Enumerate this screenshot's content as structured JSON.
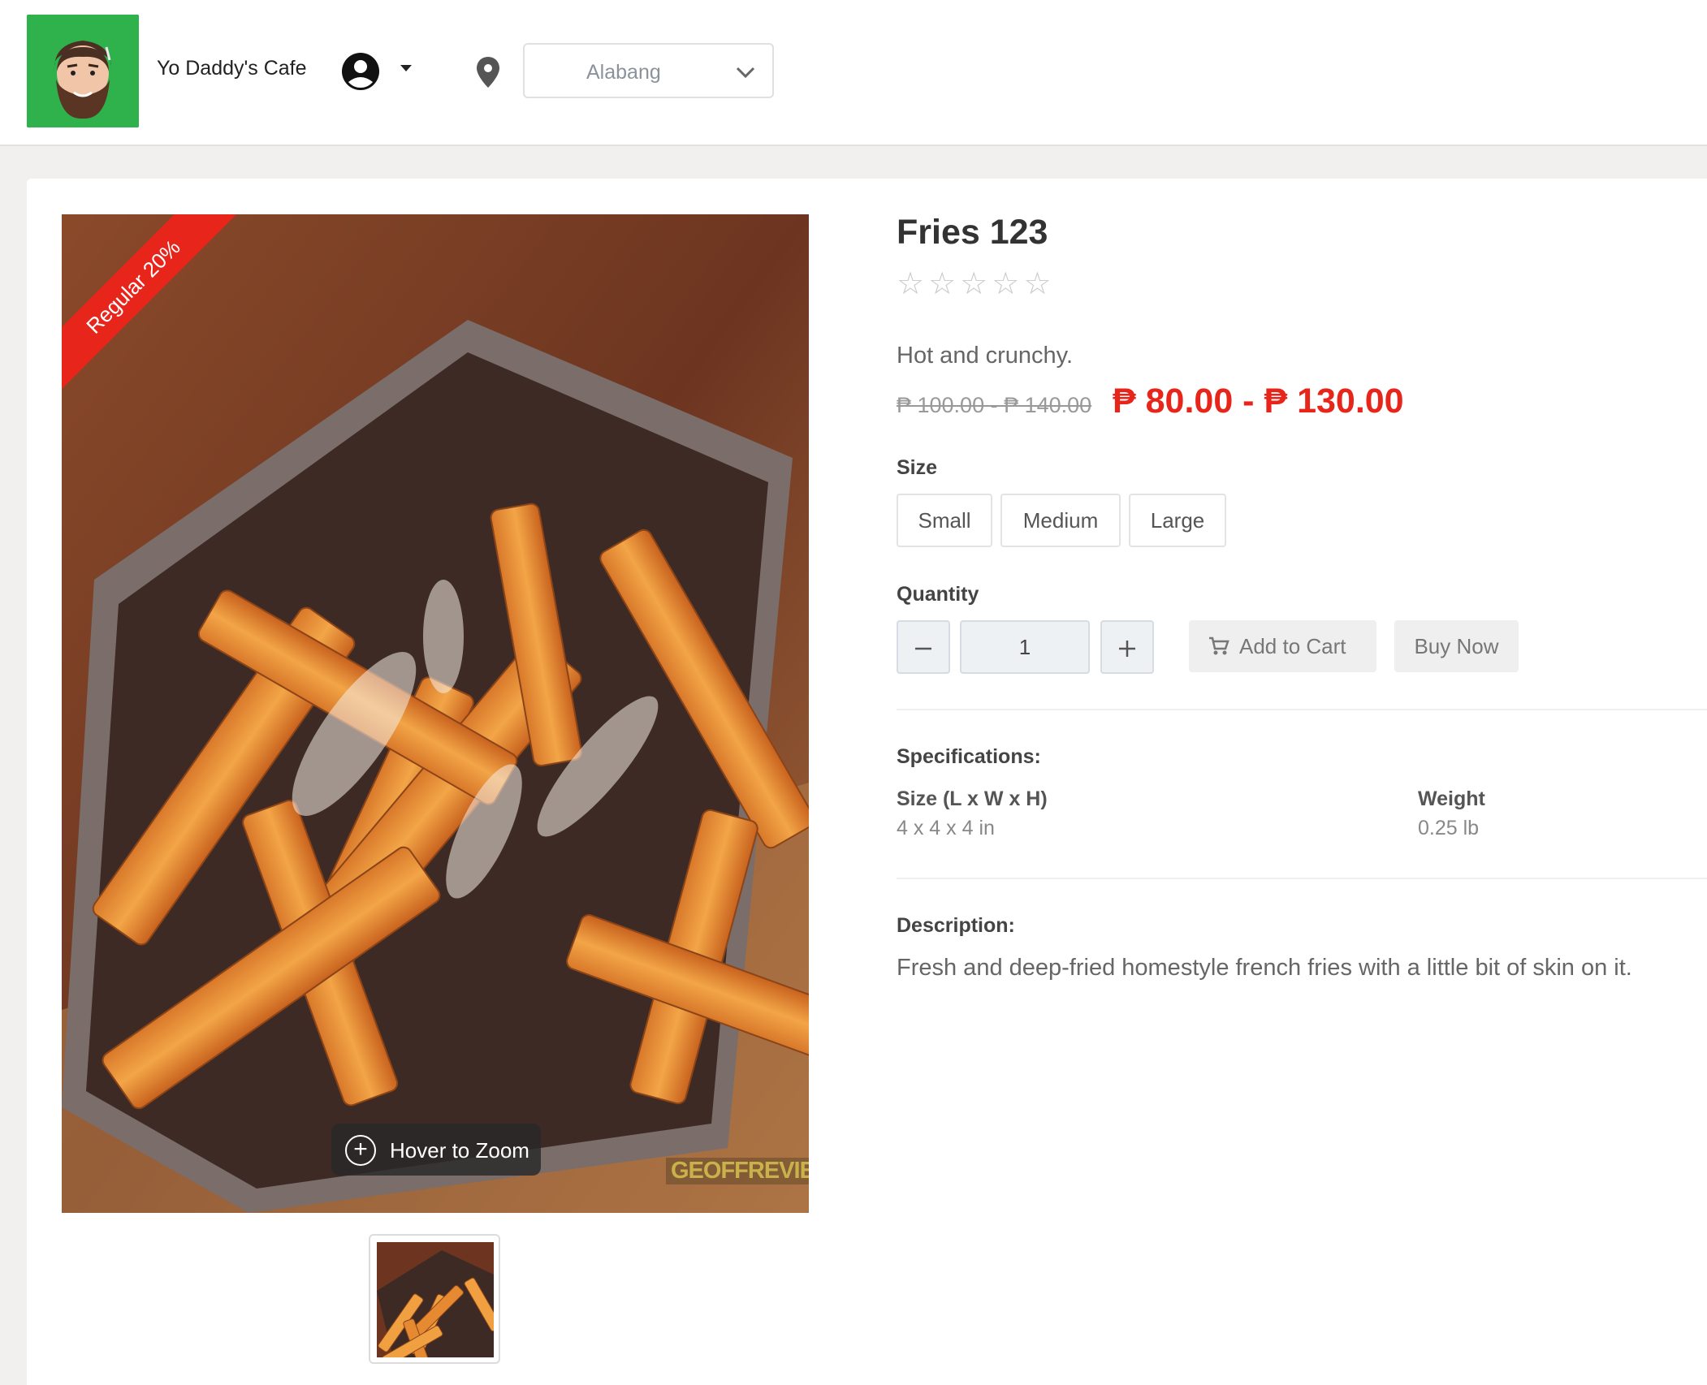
{
  "header": {
    "brand_name": "Yo Daddy's Cafe",
    "location": {
      "selected": "Alabang"
    }
  },
  "product": {
    "badge": "Regular 20%",
    "zoom_hint": "Hover to Zoom",
    "watermark": "GEOFFREVIEW",
    "title": "Fries 123",
    "rating": {
      "value": 0,
      "max": 5
    },
    "tagline": "Hot and crunchy.",
    "original_price": "₱ 100.00 - ₱ 140.00",
    "sale_price": "₱ 80.00 - ₱ 130.00",
    "size_label": "Size",
    "sizes": [
      "Small",
      "Medium",
      "Large"
    ],
    "quantity_label": "Quantity",
    "quantity": "1",
    "add_to_cart": "Add to Cart",
    "buy_now": "Buy Now",
    "specifications_label": "Specifications:",
    "specs": [
      {
        "key": "Size (L x W x H)",
        "value": "4 x 4 x 4 in"
      },
      {
        "key": "Weight",
        "value": "0.25 lb"
      }
    ],
    "description_label": "Description:",
    "description": "Fresh and deep-fried homestyle french fries with a little bit of skin on it."
  },
  "colors": {
    "accent_red": "#e8251b",
    "logo_green": "#2fb24c"
  }
}
